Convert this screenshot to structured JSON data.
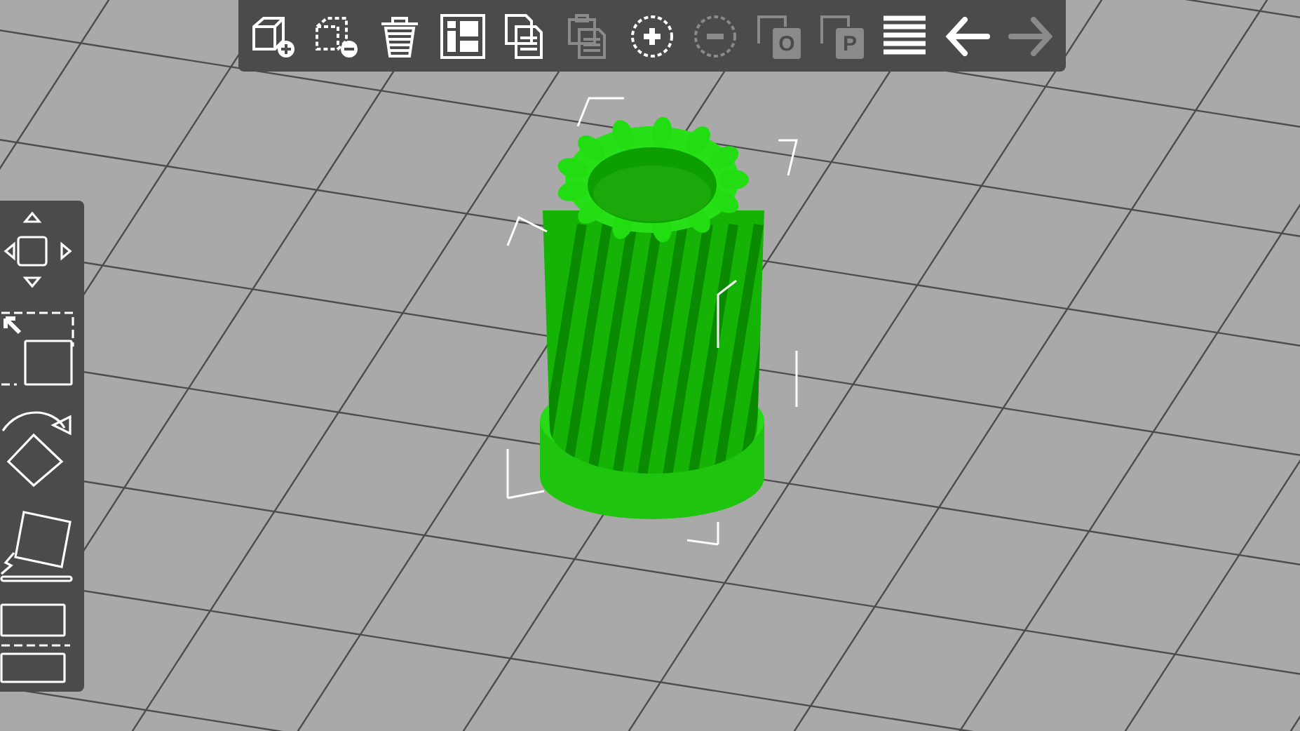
{
  "toolbar": {
    "items": [
      {
        "kind": "add",
        "disabled": false
      },
      {
        "kind": "delete",
        "disabled": false
      },
      {
        "kind": "delete-all",
        "disabled": false
      },
      {
        "kind": "arrange",
        "disabled": false
      },
      {
        "kind": "copy",
        "disabled": false
      },
      {
        "kind": "paste",
        "disabled": true
      },
      {
        "kind": "more",
        "disabled": false
      },
      {
        "kind": "fewer",
        "disabled": true
      },
      {
        "kind": "split-objects",
        "disabled": true,
        "letter": "O"
      },
      {
        "kind": "split-parts",
        "disabled": true,
        "letter": "P"
      },
      {
        "kind": "layers",
        "disabled": false
      },
      {
        "kind": "undo",
        "disabled": false
      },
      {
        "kind": "redo",
        "disabled": true
      }
    ]
  },
  "sidebar": {
    "tools": [
      {
        "kind": "move"
      },
      {
        "kind": "scale"
      },
      {
        "kind": "rotate"
      },
      {
        "kind": "place-on-face"
      },
      {
        "kind": "cut"
      }
    ]
  }
}
